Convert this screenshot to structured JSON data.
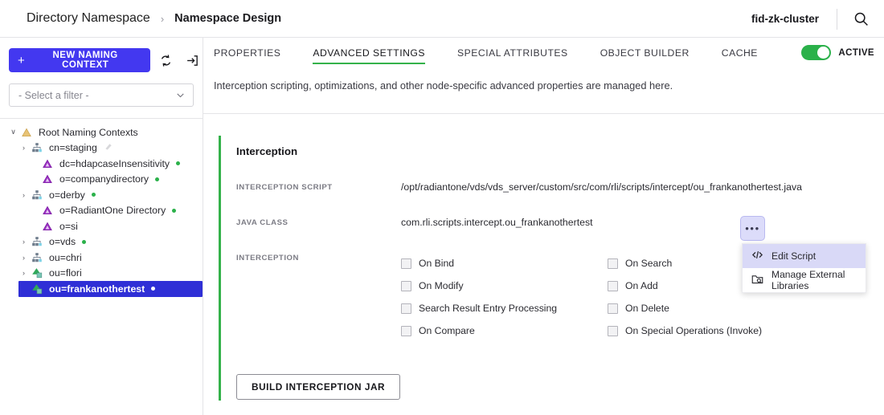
{
  "header": {
    "breadcrumb_root": "Directory Namespace",
    "breadcrumb_separator": "›",
    "breadcrumb_current": "Namespace Design",
    "cluster_name": "fid-zk-cluster",
    "search_icon": "search-icon"
  },
  "sidebar": {
    "new_context_button": "NEW NAMING CONTEXT",
    "plus": "+",
    "refresh_icon": "refresh-icon",
    "import_icon": "import-icon",
    "filter_placeholder": "- Select a filter -",
    "tree": [
      {
        "label": "Root Naming Contexts",
        "level": 0,
        "caret": "∨",
        "icon": "triangle-amber",
        "dot": false,
        "selected": false,
        "ghost": false
      },
      {
        "label": "cn=staging",
        "level": 1,
        "caret": "›",
        "icon": "hierarchy-blue",
        "dot": false,
        "selected": false,
        "ghost": true
      },
      {
        "label": "dc=hdapcaseInsensitivity",
        "level": 2,
        "caret": "",
        "icon": "triangle-purple",
        "dot": true,
        "selected": false,
        "ghost": false
      },
      {
        "label": "o=companydirectory",
        "level": 2,
        "caret": "",
        "icon": "triangle-purple",
        "dot": true,
        "selected": false,
        "ghost": false
      },
      {
        "label": "o=derby",
        "level": 1,
        "caret": "›",
        "icon": "hierarchy-blue",
        "dot": true,
        "selected": false,
        "ghost": false
      },
      {
        "label": "o=RadiantOne Directory",
        "level": 2,
        "caret": "",
        "icon": "triangle-purple",
        "dot": true,
        "selected": false,
        "ghost": false
      },
      {
        "label": "o=si",
        "level": 2,
        "caret": "",
        "icon": "triangle-purple",
        "dot": false,
        "selected": false,
        "ghost": false
      },
      {
        "label": "o=vds",
        "level": 1,
        "caret": "›",
        "icon": "hierarchy-blue",
        "dot": true,
        "selected": false,
        "ghost": false
      },
      {
        "label": "ou=chri",
        "level": 1,
        "caret": "›",
        "icon": "hierarchy-blue",
        "dot": false,
        "selected": false,
        "ghost": false
      },
      {
        "label": "ou=flori",
        "level": 1,
        "caret": "›",
        "icon": "hierarchy-green",
        "dot": false,
        "selected": false,
        "ghost": false
      },
      {
        "label": "ou=frankanothertest",
        "level": 1,
        "caret": "",
        "icon": "hierarchy-green",
        "dot": true,
        "selected": true,
        "ghost": false
      }
    ]
  },
  "main": {
    "tabs": [
      {
        "label": "PROPERTIES",
        "active": false
      },
      {
        "label": "ADVANCED SETTINGS",
        "active": true
      },
      {
        "label": "SPECIAL ATTRIBUTES",
        "active": false
      },
      {
        "label": "OBJECT BUILDER",
        "active": false
      },
      {
        "label": "CACHE",
        "active": false
      }
    ],
    "status_toggle_label": "ACTIVE",
    "status_toggle_on": true,
    "subtitle": "Interception scripting, optimizations, and other node-specific advanced properties are managed here.",
    "card": {
      "title": "Interception",
      "interception_script_label": "INTERCEPTION SCRIPT",
      "interception_script_value": "/opt/radiantone/vds/vds_server/custom/src/com/rli/scripts/intercept/ou_frankanothertest.java",
      "kebab_label": "•••",
      "java_class_label": "JAVA CLASS",
      "java_class_value": "com.rli.scripts.intercept.ou_frankanothertest",
      "interception_label": "INTERCEPTION",
      "checkboxes": [
        {
          "label": "On Bind",
          "checked": false
        },
        {
          "label": "On Search",
          "checked": false
        },
        {
          "label": "On Modify",
          "checked": false
        },
        {
          "label": "On Add",
          "checked": false
        },
        {
          "label": "Search Result Entry Processing",
          "checked": false
        },
        {
          "label": "On Delete",
          "checked": false
        },
        {
          "label": "On Compare",
          "checked": false
        },
        {
          "label": "On Special Operations (Invoke)",
          "checked": false
        }
      ],
      "build_button": "BUILD INTERCEPTION JAR"
    },
    "dropdown": {
      "visible": true,
      "items": [
        {
          "label": "Edit Script",
          "icon": "code-icon",
          "highlight": true
        },
        {
          "label": "Manage External Libraries",
          "icon": "folder-search-icon",
          "highlight": false
        }
      ]
    }
  },
  "colors": {
    "accent_green": "#34b24a",
    "primary_indigo": "#4338f0",
    "selected_blue": "#2f2fd6",
    "dropdown_highlight": "#d9d9f7"
  }
}
